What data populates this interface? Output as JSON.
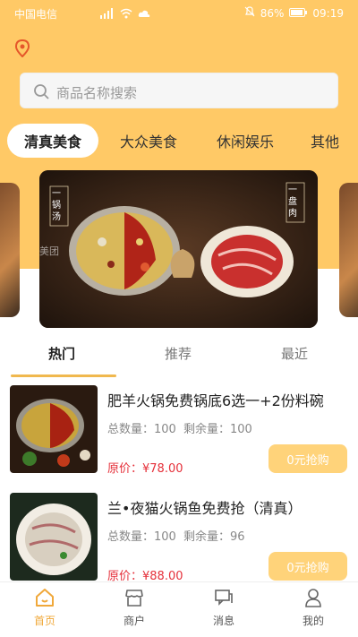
{
  "status_bar": {
    "carrier": "中国电信",
    "battery": "86%",
    "time": "09:19"
  },
  "search": {
    "placeholder": "商品名称搜索"
  },
  "categories": [
    {
      "label": "清真美食",
      "active": true
    },
    {
      "label": "大众美食",
      "active": false
    },
    {
      "label": "休闲娱乐",
      "active": false
    },
    {
      "label": "其他",
      "active": false
    }
  ],
  "banner": {
    "left_vertical_text": "一锅汤",
    "right_vertical_text": "一盘肉",
    "watermark": "美团"
  },
  "tabs": [
    {
      "label": "热门",
      "active": true
    },
    {
      "label": "推荐",
      "active": false
    },
    {
      "label": "最近",
      "active": false
    }
  ],
  "products": [
    {
      "title": "肥羊火锅免费锅底6选一+2份料碗",
      "total_label": "总数量：",
      "total": "100",
      "remain_label": "剩余量：",
      "remain": "100",
      "price": "原价：¥78.00",
      "button": "0元抢购"
    },
    {
      "title": "兰•夜猫火锅鱼免费抢（清真）",
      "total_label": "总数量：",
      "total": "100",
      "remain_label": "剩余量：",
      "remain": "96",
      "price": "原价：¥88.00",
      "button": "0元抢购"
    }
  ],
  "tabbar": [
    {
      "label": "首页",
      "icon": "home-icon",
      "active": true
    },
    {
      "label": "商户",
      "icon": "store-icon",
      "active": false
    },
    {
      "label": "消息",
      "icon": "message-icon",
      "active": false
    },
    {
      "label": "我的",
      "icon": "user-icon",
      "active": false
    }
  ],
  "colors": {
    "header": "#ffc966",
    "accent": "#f0a83a",
    "button": "#ffd37a",
    "price": "#e5303a"
  }
}
